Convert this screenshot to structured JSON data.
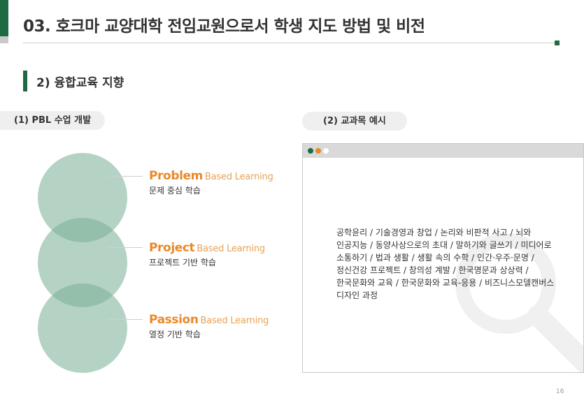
{
  "header": {
    "title": "03. 호크마 교양대학 전임교원으로서 학생 지도 방법 및 비전",
    "accent_color": "#1e6b43"
  },
  "section": {
    "heading": "2) 융합교육 지향"
  },
  "pbl": {
    "label": "(1) PBL 수업 개발",
    "items": [
      {
        "name": "Problem",
        "suffix": "Based Learning",
        "desc": "문제 중심 학습"
      },
      {
        "name": "Project",
        "suffix": "Based Learning",
        "desc": "프로젝트 기반 학습"
      },
      {
        "name": "Passion",
        "suffix": "Based Learning",
        "desc": "열정 기반 학습"
      }
    ],
    "highlight_color": "#e88a2a"
  },
  "courses": {
    "label": "(2) 교과목 예시",
    "text": "공학윤리 / 기술경영과 창업 / 논리와 비판적 사고 / 뇌와 인공지능 / 동양사상으로의 초대 / 말하기와 글쓰기 / 미디어로 소통하기 / 법과 생활 / 생활 속의 수학 / 인간·우주·문명 / 정신건강 프로젝트 / 창의성 계발 / 한국명문과 상상력 / 한국문화와 교육 / 한국문화와 교육-응용 / 비즈니스모델캔버스 디자인 과정"
  },
  "page_number": "16"
}
